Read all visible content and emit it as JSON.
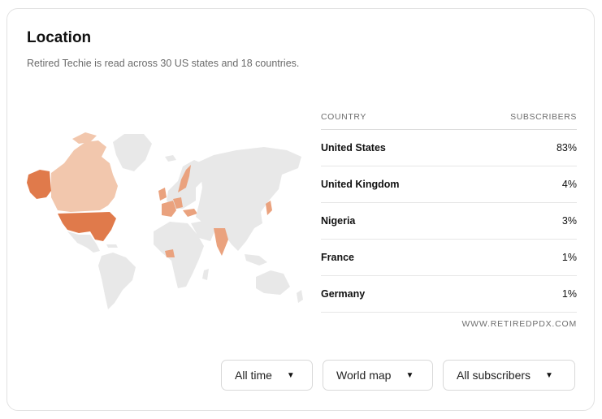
{
  "header": {
    "title": "Location",
    "subtitle": "Retired Techie is read across 30 US states and 18 countries."
  },
  "table": {
    "col_country": "COUNTRY",
    "col_subscribers": "SUBSCRIBERS",
    "rows": [
      {
        "country": "United States",
        "share": "83%"
      },
      {
        "country": "United Kingdom",
        "share": "4%"
      },
      {
        "country": "Nigeria",
        "share": "3%"
      },
      {
        "country": "France",
        "share": "1%"
      },
      {
        "country": "Germany",
        "share": "1%"
      }
    ]
  },
  "watermark": "WWW.RETIREDPDX.COM",
  "filters": {
    "time": "All time",
    "view": "World map",
    "audience": "All subscribers"
  },
  "colors": {
    "map_base": "#e8e8e8",
    "map_high": "#e07a4b",
    "map_mid": "#eaa27e",
    "map_low": "#f2c7ad"
  },
  "icons": {
    "dropdown": "caret-down-icon"
  }
}
